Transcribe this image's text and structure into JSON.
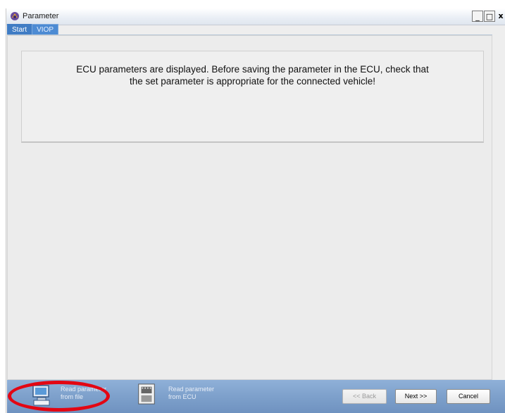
{
  "window": {
    "title": "Parameter",
    "controls": {
      "minimize": "_",
      "maximize": "□",
      "close": "x"
    }
  },
  "tabs": [
    {
      "label": "Start",
      "active": true
    },
    {
      "label": "VIOP",
      "active": false
    }
  ],
  "info": {
    "line1": "ECU parameters are displayed. Before saving the parameter in the ECU, check that",
    "line2": "the set parameter is appropriate for the connected vehicle!"
  },
  "footer": {
    "read_file": {
      "line1": "Read parameter",
      "line2": "from file",
      "icon": "computer-icon"
    },
    "read_ecu": {
      "line1": "Read parameter",
      "line2": "from ECU",
      "icon": "ecu-icon"
    },
    "back_label": "<< Back",
    "next_label": "Next >>",
    "cancel_label": "Cancel"
  },
  "colors": {
    "footer": "#7c9fca",
    "tab_active": "#3f7cc4",
    "highlight": "#e30613"
  }
}
